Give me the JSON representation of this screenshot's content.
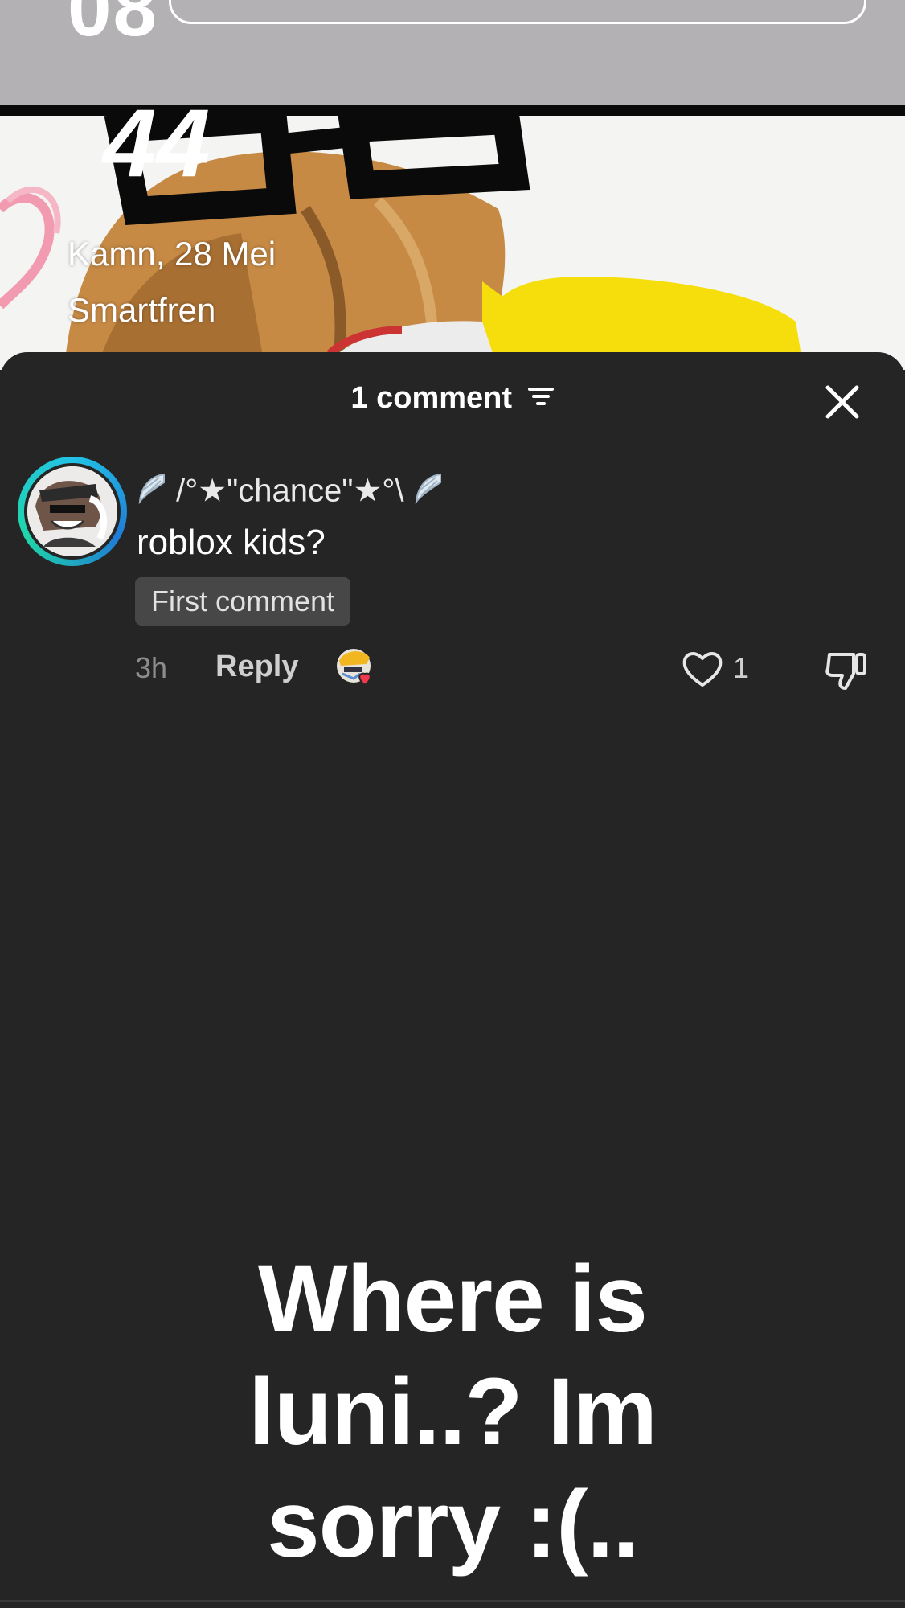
{
  "video": {
    "clock_text": "08",
    "clock_text_2": "44",
    "date": "Kamn, 28 Mei",
    "carrier": "Smartfren"
  },
  "sheet": {
    "comment_count_label": "1 comment",
    "filter_icon": "filter-icon",
    "close_icon": "close-icon"
  },
  "comments": [
    {
      "username": "/°★\"chance\"★°\\",
      "username_prefix_icon": "wing-icon",
      "username_suffix_icon": "wing-icon",
      "text": "roblox kids?",
      "badge": "First comment",
      "timestamp": "3h",
      "reply_label": "Reply",
      "like_count": "1"
    }
  ],
  "caption": {
    "text": "Where is luni..? Im sorry :(.."
  },
  "colors": {
    "sheet_bg": "#252525",
    "avatar_ring": "#22c3e6",
    "badge_bg": "#474747",
    "heart_red": "#f2384f"
  }
}
